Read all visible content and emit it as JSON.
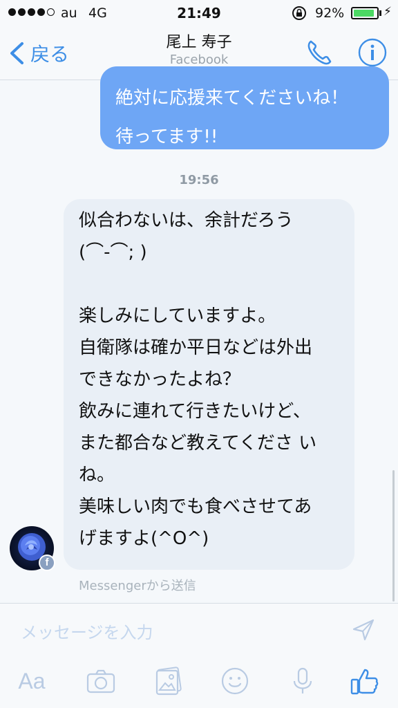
{
  "status_bar": {
    "carrier": "au",
    "network": "4G",
    "time": "21:49",
    "battery_percent": "92%",
    "battery_level": 0.92
  },
  "header": {
    "back_label": "戻る",
    "title": "尾上 寿子",
    "subtitle": "Facebook"
  },
  "messages": {
    "outgoing": {
      "lines": [
        "絶対に応援来てくださいね！",
        "待ってます!!"
      ]
    },
    "timestamp": "19:56",
    "incoming": {
      "lines": [
        "似合わないは、余計だろう",
        "(⌒-⌒; )",
        "",
        "楽しみにしていますよ。",
        "自衛隊は確か平日などは外出",
        "できなかったよね？",
        "飲みに連れて行きたいけど、",
        "また都合など教えてくださ い",
        "ね。",
        "美味しい肉でも食べさせてあ",
        "げますよ(^O^)"
      ],
      "sent_via": "Messengerから送信"
    }
  },
  "composer": {
    "placeholder": "メッセージを入力",
    "text_format_label": "Aa"
  },
  "colors": {
    "accent": "#3d8ee6",
    "outgoing_bubble": "#6ea6f5",
    "incoming_bubble": "#e9eff6",
    "toolbar_icon": "#b9cbe3",
    "like_icon": "#3d8ee6"
  },
  "icons": [
    "back-chevron-icon",
    "phone-icon",
    "info-icon",
    "send-icon",
    "camera-icon",
    "photo-icon",
    "emoji-icon",
    "microphone-icon",
    "thumbs-up-icon",
    "lock-rotation-icon",
    "charging-icon"
  ]
}
